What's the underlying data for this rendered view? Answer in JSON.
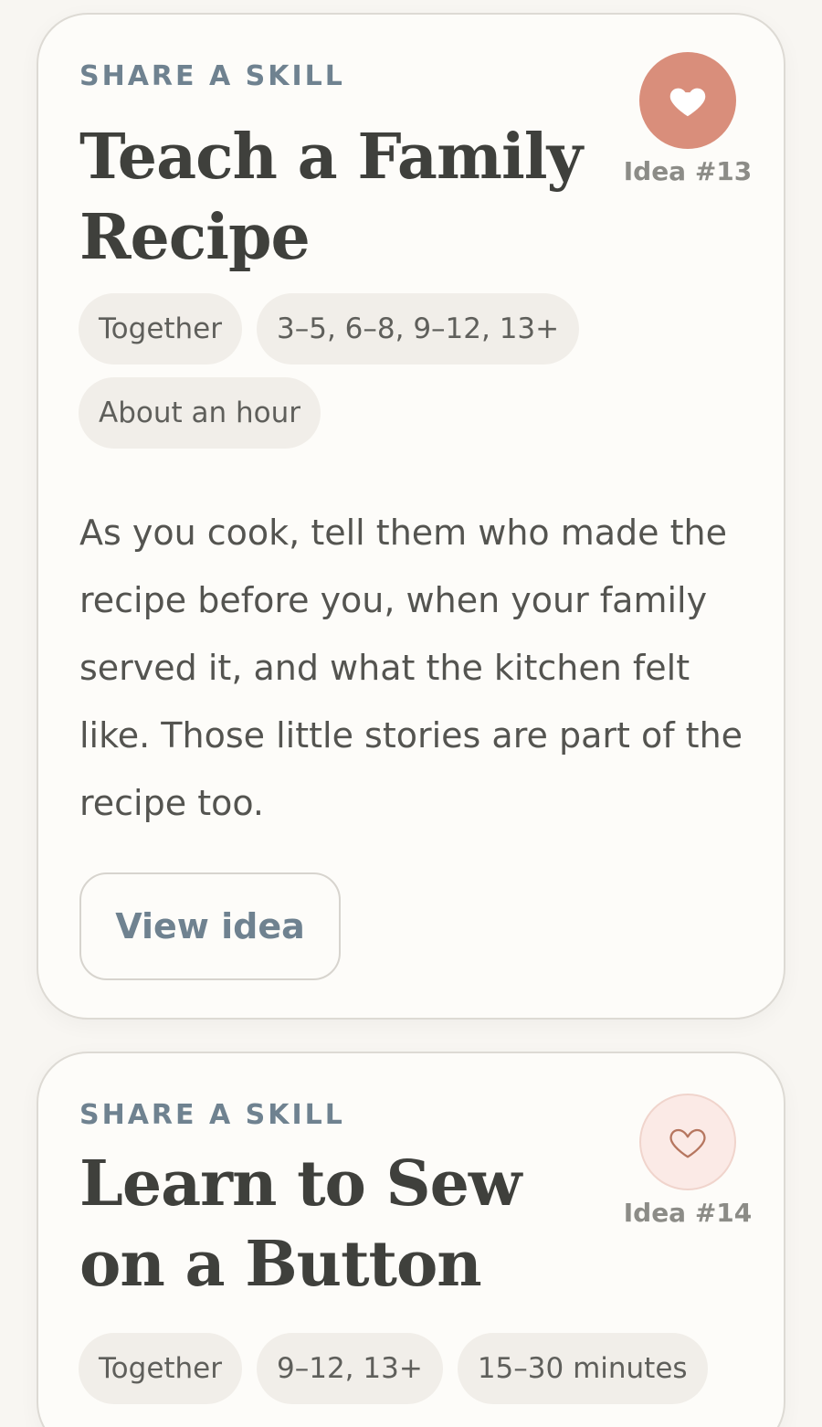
{
  "cards": [
    {
      "eyebrow": "SHARE A SKILL",
      "title": "Teach a Family Recipe",
      "idea_number": "Idea #13",
      "favorited": true,
      "tags": [
        "Together",
        "3–5, 6–8, 9–12, 13+",
        "About an hour"
      ],
      "description": "As you cook, tell them who made the recipe before you, when your family served it, and what the kitchen felt like. Those little stories are part of the recipe too.",
      "button_label": "View idea"
    },
    {
      "eyebrow": "SHARE A SKILL",
      "title": "Learn to Sew on a Button",
      "idea_number": "Idea #14",
      "favorited": false,
      "tags": [
        "Together",
        "9–12, 13+",
        "15–30 minutes"
      ]
    }
  ],
  "colors": {
    "accent_heart": "#d98e7b",
    "accent_heart_light": "#fbeae6",
    "eyebrow": "#6f8290",
    "title": "#3f403c",
    "tag_bg": "#f1eee9"
  },
  "icons": {
    "favorite_filled": "heart-filled-icon",
    "favorite_outline": "heart-outline-icon"
  }
}
